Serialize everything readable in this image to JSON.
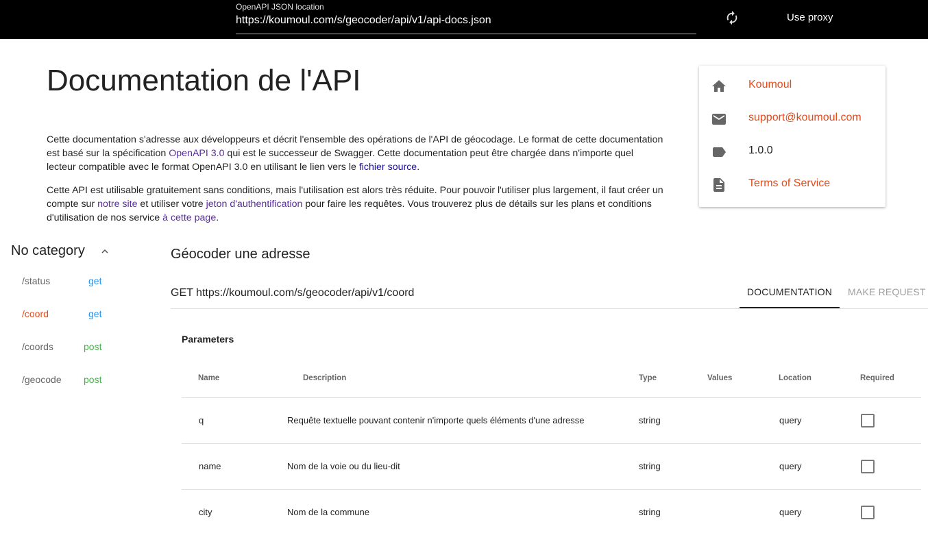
{
  "topbar": {
    "url_label": "OpenAPI JSON location",
    "url_value": "https://koumoul.com/s/geocoder/api/v1/api-docs.json",
    "refresh_icon": "refresh-icon",
    "proxy_label": "Use proxy"
  },
  "page": {
    "title": "Documentation de l'API",
    "p1": {
      "t1": "Cette documentation s'adresse aux développeurs et décrit l'ensemble des opérations de l'API de géocodage. Le format de cette documentation est basé sur la spécification ",
      "link1": "OpenAPI 3.0",
      "t2": " qui est le successeur de Swagger. Cette documentation peut être chargée dans n'importe quel lecteur compatible avec le format OpenAPI 3.0 en utilisant le lien vers le ",
      "link2": "fichier source",
      "t3": "."
    },
    "p2": {
      "t1": "Cette API est utilisable gratuitement sans conditions, mais l'utilisation est alors très réduite. Pour pouvoir l'utiliser plus largement, il faut créer un compte sur ",
      "link1": "notre site",
      "t2": " et utiliser votre ",
      "link2": "jeton d'authentification",
      "t3": " pour faire les requêtes. Vous trouverez plus de détails sur les plans et conditions d'utilisation de nos service ",
      "link3": "à cette page",
      "t4": "."
    }
  },
  "info": {
    "contact_name": "Koumoul",
    "email": "support@koumoul.com",
    "version": "1.0.0",
    "terms": "Terms of Service",
    "accent": "#e64a19"
  },
  "sidebar": {
    "category": "No category",
    "routes": [
      {
        "path": "/status",
        "method": "get"
      },
      {
        "path": "/coord",
        "method": "get"
      },
      {
        "path": "/coords",
        "method": "post"
      },
      {
        "path": "/geocode",
        "method": "post"
      }
    ]
  },
  "operation": {
    "title": "Géocoder une adresse",
    "endpoint": "GET https://koumoul.com/s/geocoder/api/v1/coord",
    "tabs": [
      "DOCUMENTATION",
      "MAKE REQUEST"
    ],
    "params_heading": "Parameters",
    "columns": [
      "Name",
      "Description",
      "Type",
      "Values",
      "Location",
      "Required"
    ],
    "rows": [
      {
        "name": "q",
        "description": "Requête textuelle pouvant contenir n'importe quels éléments d'une adresse",
        "type": "string",
        "values": "",
        "location": "query",
        "required": false
      },
      {
        "name": "name",
        "description": "Nom de la voie ou du lieu-dit",
        "type": "string",
        "values": "",
        "location": "query",
        "required": false
      },
      {
        "name": "city",
        "description": "Nom de la commune",
        "type": "string",
        "values": "",
        "location": "query",
        "required": false
      }
    ]
  },
  "colors": {
    "get": "#2196f3",
    "post": "#4caf50",
    "link": "#1a0dab"
  }
}
